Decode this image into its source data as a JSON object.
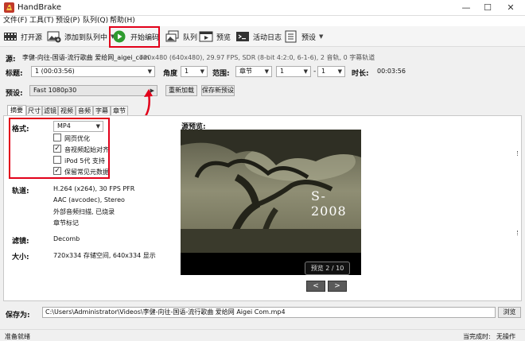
{
  "window": {
    "title": "HandBrake",
    "minimize": "—",
    "maximize": "☐",
    "close": "✕"
  },
  "menu": [
    "文件(F)",
    "工具(T)",
    "预设(P)",
    "队列(Q)",
    "帮助(H)"
  ],
  "toolbar": {
    "open_source": "打开源",
    "add_to_queue": "添加到队列中",
    "start_encode": "开始编码",
    "queue": "队列",
    "preview": "预览",
    "activity_log": "活动日志",
    "presets": "预设"
  },
  "source": {
    "label": "源:",
    "name": "李健-向往-国语-流行歌曲 爱给网_aigei_com",
    "info": "720x480 (640x480), 29.97 FPS, SDR (8-bit 4:2:0, 6-1-6), 2 音轨, 0 字幕轨道"
  },
  "title_row": {
    "title_label": "标题:",
    "title_value": "1 (00:03:56)",
    "angle_label": "角度",
    "angle_value": "1",
    "range_label": "范围:",
    "range_type": "章节",
    "range_start": "1",
    "range_sep": "-",
    "range_end": "1",
    "duration_label": "时长:",
    "duration_value": "00:03:56"
  },
  "preset_row": {
    "label": "预设:",
    "value": "Fast 1080p30",
    "reload": "重新加载",
    "save_new": "保存新预设"
  },
  "tabs": [
    "摘要",
    "尺寸",
    "滤镜",
    "视频",
    "音频",
    "字幕",
    "章节"
  ],
  "summary": {
    "format_label": "格式:",
    "format_value": "MP4",
    "options": [
      {
        "label": "网页优化",
        "checked": false
      },
      {
        "label": "音视频起始对齐",
        "checked": true
      },
      {
        "label": "iPod 5代 支持",
        "checked": false
      },
      {
        "label": "保留常见元数据",
        "checked": true
      }
    ],
    "tracks_label": "轨道:",
    "tracks": [
      "H.264 (x264), 30 FPS PFR",
      "AAC (avcodec), Stereo",
      "外部音频扫描, 已烧录",
      "章节标记"
    ],
    "filters_label": "滤镜:",
    "filters_value": "Decomb",
    "size_label": "大小:",
    "size_value": "720x334 存储空间, 640x334 显示"
  },
  "preview": {
    "label": "源预览:",
    "overlay_text": "S-2008",
    "counter": "预览 2 / 10",
    "prev": "<",
    "next": ">"
  },
  "save": {
    "label": "保存为:",
    "path": "C:\\Users\\Administrator\\Videos\\李健-向往-国语-流行歌曲 爱给网 Aigei Com.mp4",
    "browse": "浏览"
  },
  "status": {
    "left": "准备就绪",
    "when_done_label": "当完成时:",
    "when_done_value": "无操作"
  },
  "colors": {
    "highlight": "#e2001a",
    "start_green": "#2e9b2e"
  }
}
